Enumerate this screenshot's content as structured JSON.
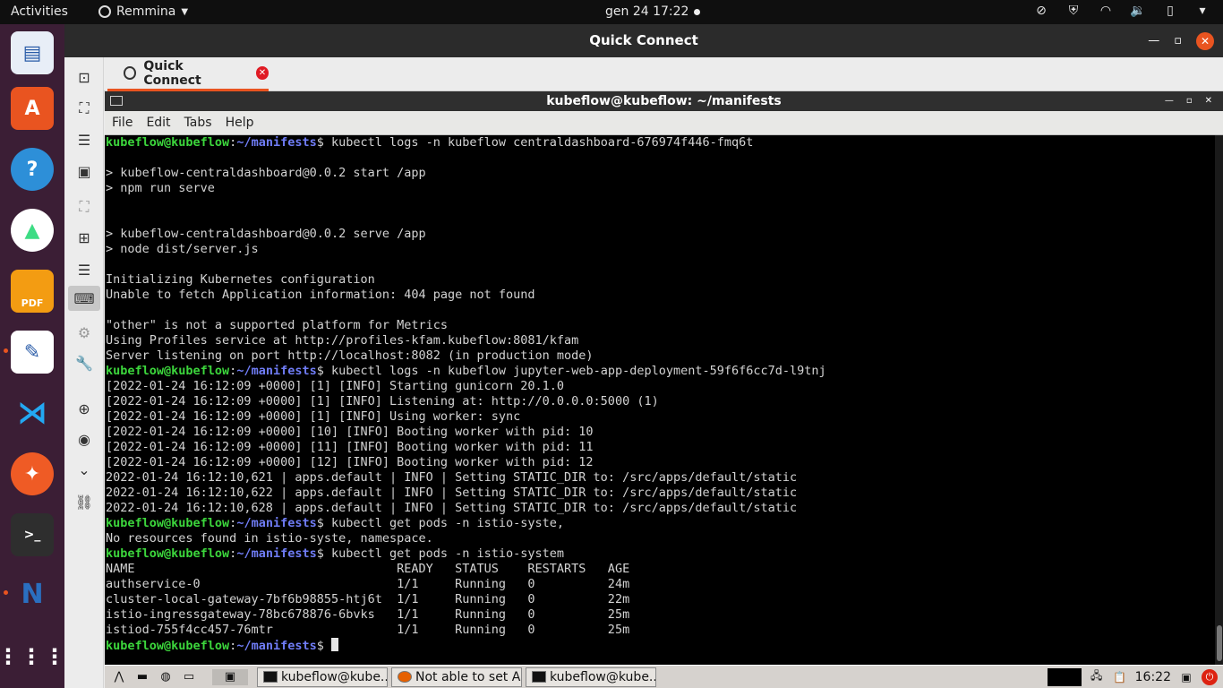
{
  "topbar": {
    "activities": "Activities",
    "app_name": "Remmina",
    "clock": "gen 24  17:22"
  },
  "dock": {
    "items": [
      "document-viewer-icon",
      "ubuntu-software-icon",
      "help-icon",
      "android-studio-icon",
      "pdf-editor-icon",
      "text-editor-icon",
      "vscode-icon",
      "postman-icon",
      "terminal-icon",
      "nomachine-icon",
      "show-apps-icon"
    ]
  },
  "remmina": {
    "title": "Quick Connect",
    "tab_label": "Quick Connect"
  },
  "terminal": {
    "title": "kubeflow@kubeflow: ~/manifests",
    "menu": [
      "File",
      "Edit",
      "Tabs",
      "Help"
    ],
    "lines": [
      {
        "p": true,
        "cmd": "kubectl logs -n kubeflow centraldashboard-676974f446-fmq6t"
      },
      {
        "t": ""
      },
      {
        "t": "> kubeflow-centraldashboard@0.0.2 start /app"
      },
      {
        "t": "> npm run serve"
      },
      {
        "t": ""
      },
      {
        "t": ""
      },
      {
        "t": "> kubeflow-centraldashboard@0.0.2 serve /app"
      },
      {
        "t": "> node dist/server.js"
      },
      {
        "t": ""
      },
      {
        "t": "Initializing Kubernetes configuration"
      },
      {
        "t": "Unable to fetch Application information: 404 page not found"
      },
      {
        "t": ""
      },
      {
        "t": "\"other\" is not a supported platform for Metrics"
      },
      {
        "t": "Using Profiles service at http://profiles-kfam.kubeflow:8081/kfam"
      },
      {
        "t": "Server listening on port http://localhost:8082 (in production mode)"
      },
      {
        "p": true,
        "cmd": "kubectl logs -n kubeflow jupyter-web-app-deployment-59f6f6cc7d-l9tnj"
      },
      {
        "t": "[2022-01-24 16:12:09 +0000] [1] [INFO] Starting gunicorn 20.1.0"
      },
      {
        "t": "[2022-01-24 16:12:09 +0000] [1] [INFO] Listening at: http://0.0.0.0:5000 (1)"
      },
      {
        "t": "[2022-01-24 16:12:09 +0000] [1] [INFO] Using worker: sync"
      },
      {
        "t": "[2022-01-24 16:12:09 +0000] [10] [INFO] Booting worker with pid: 10"
      },
      {
        "t": "[2022-01-24 16:12:09 +0000] [11] [INFO] Booting worker with pid: 11"
      },
      {
        "t": "[2022-01-24 16:12:09 +0000] [12] [INFO] Booting worker with pid: 12"
      },
      {
        "t": "2022-01-24 16:12:10,621 | apps.default | INFO | Setting STATIC_DIR to: /src/apps/default/static"
      },
      {
        "t": "2022-01-24 16:12:10,622 | apps.default | INFO | Setting STATIC_DIR to: /src/apps/default/static"
      },
      {
        "t": "2022-01-24 16:12:10,628 | apps.default | INFO | Setting STATIC_DIR to: /src/apps/default/static"
      },
      {
        "p": true,
        "cmd": "kubectl get pods -n istio-syste,"
      },
      {
        "t": "No resources found in istio-syste, namespace."
      },
      {
        "p": true,
        "cmd": "kubectl get pods -n istio-system"
      },
      {
        "t": "NAME                                    READY   STATUS    RESTARTS   AGE"
      },
      {
        "t": "authservice-0                           1/1     Running   0          24m"
      },
      {
        "t": "cluster-local-gateway-7bf6b98855-htj6t  1/1     Running   0          22m"
      },
      {
        "t": "istio-ingressgateway-78bc678876-6bvks   1/1     Running   0          25m"
      },
      {
        "t": "istiod-755f4cc457-76mtr                 1/1     Running   0          25m"
      },
      {
        "p": true,
        "cmd": "",
        "cursor": true
      }
    ],
    "prompt_user": "kubeflow@kubeflow",
    "prompt_sep": ":",
    "prompt_path": "~/manifests",
    "prompt_end": "$ "
  },
  "remote_taskbar": {
    "tasks": [
      {
        "label": "kubeflow@kube...",
        "icon": "terminal-icon"
      },
      {
        "label": "Not able to set A...",
        "icon": "firefox-icon"
      },
      {
        "label": "kubeflow@kube...",
        "icon": "terminal-icon"
      }
    ],
    "clock": "16:22"
  }
}
